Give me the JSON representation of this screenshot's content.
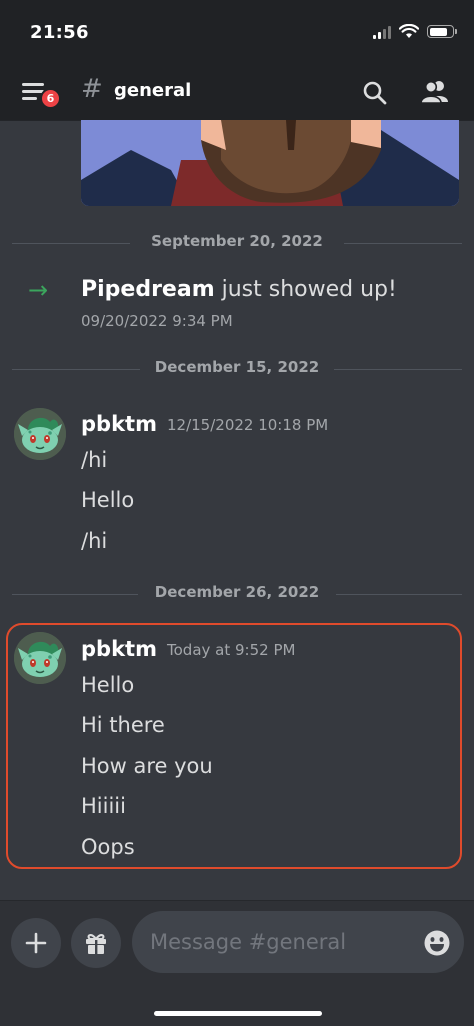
{
  "status_bar": {
    "time": "21:56"
  },
  "header": {
    "unread_badge": "6",
    "channel_name": "general"
  },
  "messages": {
    "date_1": "September 20, 2022",
    "join": {
      "name": "Pipedream",
      "action": " just showed up!",
      "timestamp": "09/20/2022 9:34 PM"
    },
    "date_2": "December 15, 2022",
    "group_1": {
      "author": "pbktm",
      "timestamp": "12/15/2022 10:18 PM",
      "lines": [
        "/hi",
        "Hello",
        "/hi"
      ]
    },
    "date_3": "December 26, 2022",
    "group_2": {
      "author": "pbktm",
      "timestamp": "Today at 9:52 PM",
      "lines": [
        "Hello",
        "Hi there",
        "How are you",
        "Hiiiii",
        "Oops"
      ]
    }
  },
  "composer": {
    "placeholder": "Message #general"
  },
  "colors": {
    "background": "#36393f",
    "header": "#202225",
    "join_arrow": "#3ba55d",
    "badge": "#ed4245",
    "highlight": "#e04b2c"
  }
}
